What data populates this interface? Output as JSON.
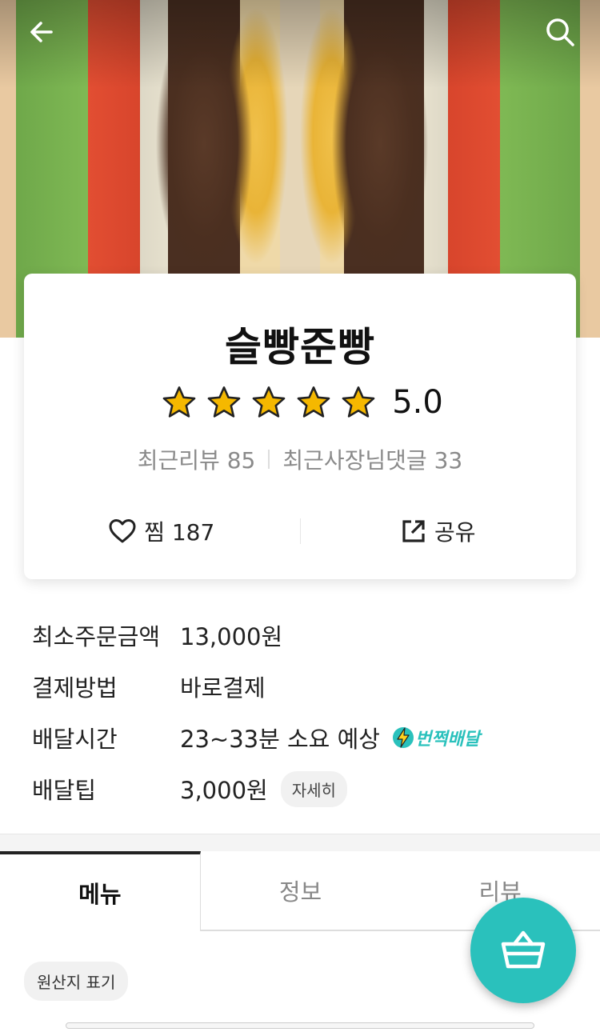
{
  "header": {
    "back_icon": "arrow-left-icon",
    "search_icon": "search-icon"
  },
  "shop": {
    "name": "슬빵준빵",
    "rating": "5.0",
    "stars_filled": 5,
    "recent_reviews": "최근리뷰 85",
    "owner_replies": "최근사장님댓글 33",
    "like_label": "찜 187",
    "share_label": "공유"
  },
  "info": {
    "min_order_label": "최소주문금액",
    "min_order_value": "13,000원",
    "payment_label": "결제방법",
    "payment_value": "바로결제",
    "delivery_time_label": "배달시간",
    "delivery_time_value": "23~33분 소요 예상",
    "flash_badge": "번쩍배달",
    "delivery_tip_label": "배달팁",
    "delivery_tip_value": "3,000원",
    "detail_button": "자세히"
  },
  "tabs": [
    {
      "label": "메뉴"
    },
    {
      "label": "정보"
    },
    {
      "label": "리뷰"
    }
  ],
  "origin_chip": "원산지 표기",
  "colors": {
    "accent": "#2ac1bc",
    "star": "#f5b800"
  }
}
